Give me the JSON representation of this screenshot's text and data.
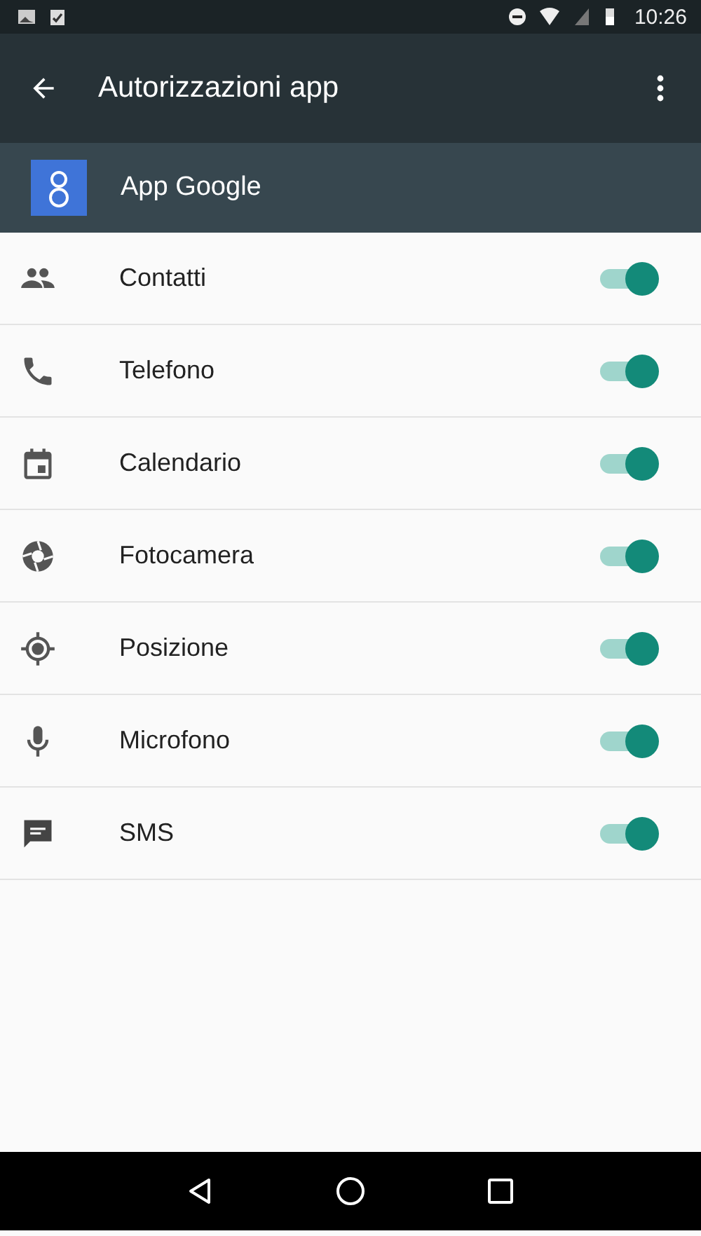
{
  "status_bar": {
    "time": "10:26"
  },
  "toolbar": {
    "title": "Autorizzazioni app"
  },
  "app": {
    "name": "App Google"
  },
  "permissions": [
    {
      "kind": "contacts",
      "label": "Contatti",
      "on": true
    },
    {
      "kind": "phone",
      "label": "Telefono",
      "on": true
    },
    {
      "kind": "calendar",
      "label": "Calendario",
      "on": true
    },
    {
      "kind": "camera",
      "label": "Fotocamera",
      "on": true
    },
    {
      "kind": "location",
      "label": "Posizione",
      "on": true
    },
    {
      "kind": "mic",
      "label": "Microfono",
      "on": true
    },
    {
      "kind": "sms",
      "label": "SMS",
      "on": true
    }
  ]
}
